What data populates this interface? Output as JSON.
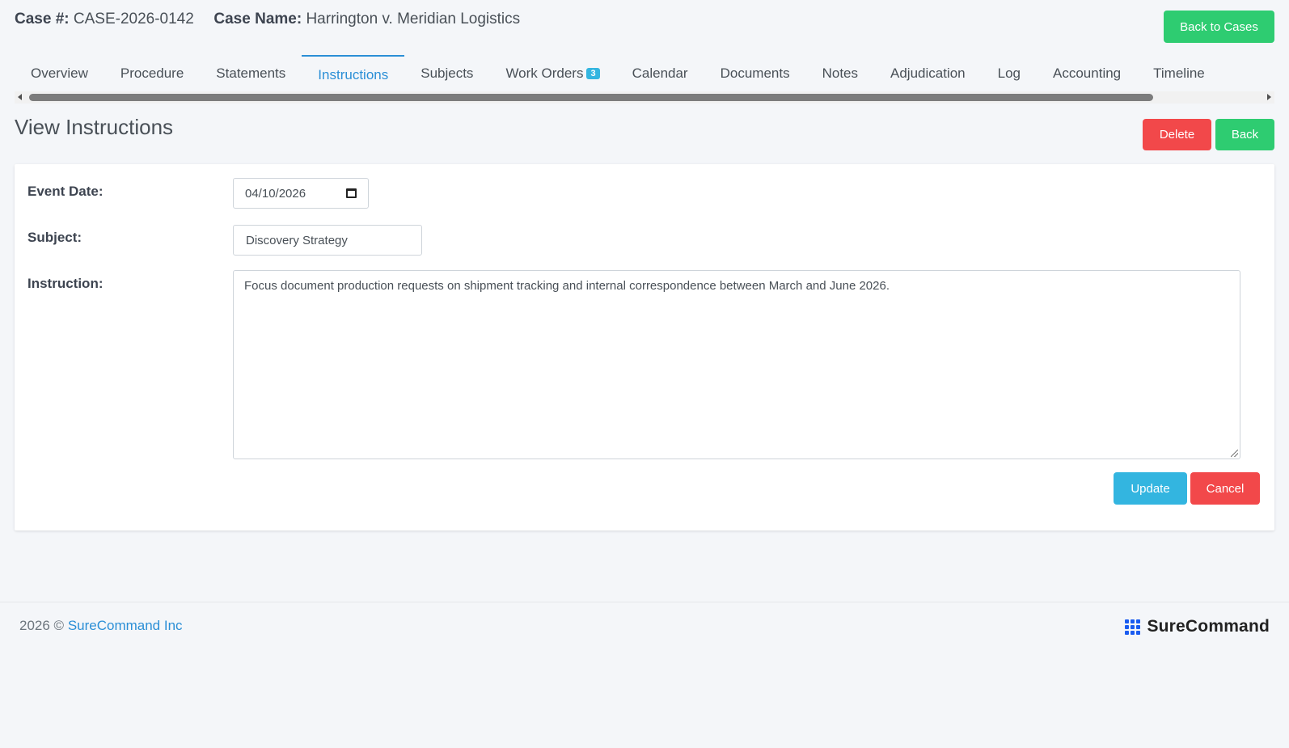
{
  "header": {
    "case_number_label": "Case #:",
    "case_number": "CASE-2026-0142",
    "case_name_label": "Case Name:",
    "case_name": "Harrington v. Meridian Logistics",
    "back_to_cases_label": "Back to Cases"
  },
  "tabs": [
    {
      "label": "Overview"
    },
    {
      "label": "Procedure"
    },
    {
      "label": "Statements"
    },
    {
      "label": "Instructions",
      "active": true
    },
    {
      "label": "Subjects"
    },
    {
      "label": "Work Orders",
      "badge": "3"
    },
    {
      "label": "Calendar"
    },
    {
      "label": "Documents"
    },
    {
      "label": "Notes"
    },
    {
      "label": "Adjudication"
    },
    {
      "label": "Log"
    },
    {
      "label": "Accounting"
    },
    {
      "label": "Timeline"
    }
  ],
  "page": {
    "title": "View Instructions",
    "delete_label": "Delete",
    "back_label": "Back"
  },
  "form": {
    "event_date_label": "Event Date:",
    "event_date_value": "04/10/2026",
    "subject_label": "Subject:",
    "subject_value": "Discovery Strategy",
    "instruction_label": "Instruction:",
    "instruction_value": "Focus document production requests on shipment tracking and internal correspondence between March and June 2026.",
    "update_label": "Update",
    "cancel_label": "Cancel"
  },
  "footer": {
    "copyright": "2026 ©",
    "company_link": "SureCommand Inc",
    "brand_name": "SureCommand"
  },
  "colors": {
    "green": "#2ecc71",
    "red": "#f2484a",
    "blue": "#33b5e0",
    "link": "#2b8fd6"
  }
}
